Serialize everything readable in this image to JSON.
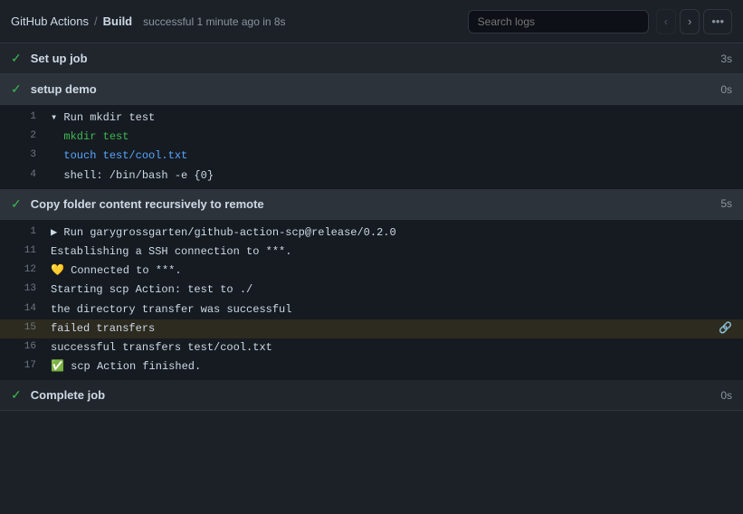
{
  "header": {
    "breadcrumb": "GitHub Actions",
    "separator": "/",
    "build": "Build",
    "status": "successful 1 minute ago in 8s",
    "search_placeholder": "Search logs",
    "prev_label": "‹",
    "next_label": "›",
    "more_label": "···"
  },
  "sections": [
    {
      "id": "setup-job",
      "label": "Set up job",
      "time": "3s",
      "expanded": false,
      "lines": []
    },
    {
      "id": "setup-demo",
      "label": "setup demo",
      "time": "0s",
      "expanded": true,
      "lines": [
        {
          "num": 1,
          "text": "▾ Run mkdir test",
          "highlight": false
        },
        {
          "num": 2,
          "text": "  mkdir test",
          "type": "green",
          "highlight": false
        },
        {
          "num": 3,
          "text": "  touch test/cool.txt",
          "type": "cyan",
          "highlight": false
        },
        {
          "num": 4,
          "text": "  shell: /bin/bash -e {0}",
          "highlight": false
        }
      ]
    },
    {
      "id": "copy-folder",
      "label": "Copy folder content recursively to remote",
      "time": "5s",
      "expanded": true,
      "lines": [
        {
          "num": 1,
          "text": "▶ Run garygrossgarten/github-action-scp@release/0.2.0",
          "highlight": false
        },
        {
          "num": 11,
          "text": "Establishing a SSH connection to ***.",
          "highlight": false
        },
        {
          "num": 12,
          "text": "💛 Connected to ***.",
          "highlight": false
        },
        {
          "num": 13,
          "text": "Starting scp Action: test to ./",
          "highlight": false
        },
        {
          "num": 14,
          "text": "the directory transfer was successful",
          "highlight": false
        },
        {
          "num": 15,
          "text": "failed transfers",
          "highlight": true
        },
        {
          "num": 16,
          "text": "successful transfers test/cool.txt",
          "highlight": false
        },
        {
          "num": 17,
          "text": "✅ scp Action finished.",
          "highlight": false
        }
      ]
    },
    {
      "id": "complete-job",
      "label": "Complete job",
      "time": "0s",
      "expanded": false,
      "lines": []
    }
  ]
}
